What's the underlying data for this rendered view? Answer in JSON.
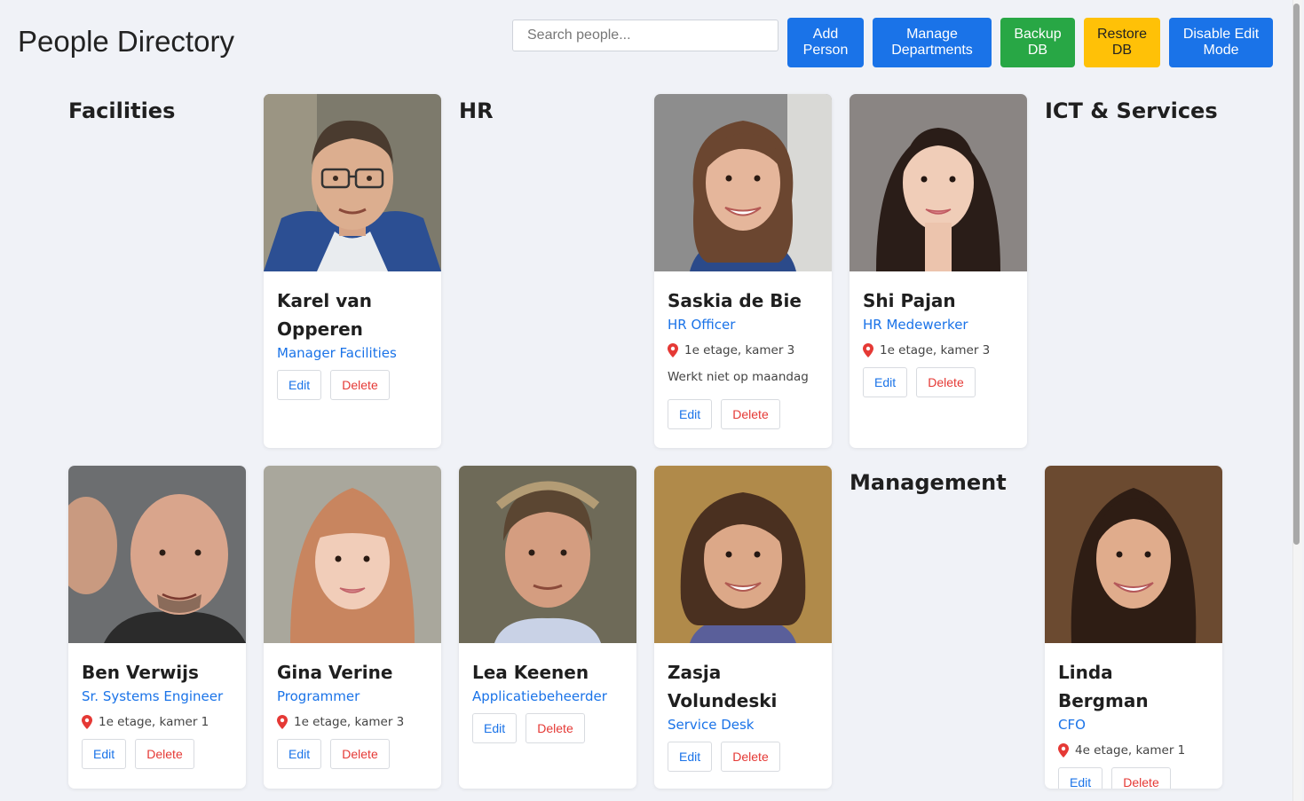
{
  "header": {
    "title": "People Directory",
    "search_placeholder": "Search people...",
    "buttons": {
      "add_person": "Add Person",
      "manage_departments": "Manage Departments",
      "backup_db": "Backup DB",
      "restore_db": "Restore DB",
      "toggle_edit": "Disable Edit Mode"
    }
  },
  "departments": {
    "facilities": "Facilities",
    "hr": "HR",
    "ict": "ICT & Services",
    "management": "Management"
  },
  "people": {
    "karel": {
      "name": "Karel van Opperen",
      "role": "Manager Facilities"
    },
    "saskia": {
      "name": "Saskia de Bie",
      "role": "HR Officer",
      "location": "1e etage, kamer 3",
      "note": "Werkt niet op maandag"
    },
    "shi": {
      "name": "Shi Pajan",
      "role": "HR Medewerker",
      "location": "1e etage, kamer 3"
    },
    "ben": {
      "name": "Ben Verwijs",
      "role": "Sr. Systems Engineer",
      "location": "1e etage, kamer 1"
    },
    "gina": {
      "name": "Gina Verine",
      "role": "Programmer",
      "location": "1e etage, kamer 3"
    },
    "lea": {
      "name": "Lea Keenen",
      "role": "Applicatiebeheerder"
    },
    "zasja": {
      "name": "Zasja Volundeski",
      "role": "Service Desk"
    },
    "linda": {
      "name": "Linda Bergman",
      "role": "CFO",
      "location": "4e etage, kamer 1"
    }
  },
  "card_actions": {
    "edit": "Edit",
    "delete": "Delete"
  },
  "colors": {
    "accent": "#1a73e8",
    "danger": "#e53935",
    "backup": "#28a745",
    "restore": "#ffc107",
    "background": "#f0f2f7"
  },
  "icons": {
    "location": "pin-icon"
  }
}
